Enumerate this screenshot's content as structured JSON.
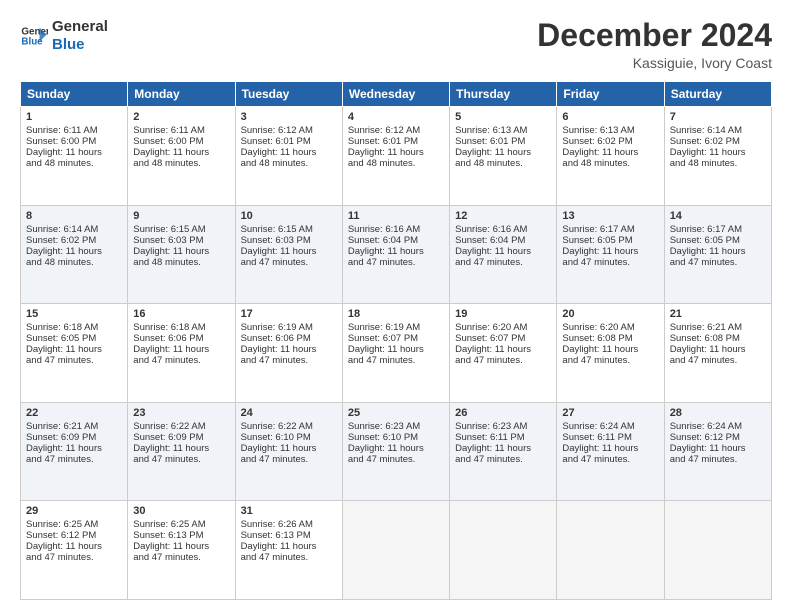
{
  "logo": {
    "line1": "General",
    "line2": "Blue"
  },
  "title": "December 2024",
  "subtitle": "Kassiguie, Ivory Coast",
  "days_header": [
    "Sunday",
    "Monday",
    "Tuesday",
    "Wednesday",
    "Thursday",
    "Friday",
    "Saturday"
  ],
  "weeks": [
    [
      {
        "day": "1",
        "sunrise": "6:11 AM",
        "sunset": "6:00 PM",
        "daylight": "11 hours and 48 minutes."
      },
      {
        "day": "2",
        "sunrise": "6:11 AM",
        "sunset": "6:00 PM",
        "daylight": "11 hours and 48 minutes."
      },
      {
        "day": "3",
        "sunrise": "6:12 AM",
        "sunset": "6:01 PM",
        "daylight": "11 hours and 48 minutes."
      },
      {
        "day": "4",
        "sunrise": "6:12 AM",
        "sunset": "6:01 PM",
        "daylight": "11 hours and 48 minutes."
      },
      {
        "day": "5",
        "sunrise": "6:13 AM",
        "sunset": "6:01 PM",
        "daylight": "11 hours and 48 minutes."
      },
      {
        "day": "6",
        "sunrise": "6:13 AM",
        "sunset": "6:02 PM",
        "daylight": "11 hours and 48 minutes."
      },
      {
        "day": "7",
        "sunrise": "6:14 AM",
        "sunset": "6:02 PM",
        "daylight": "11 hours and 48 minutes."
      }
    ],
    [
      {
        "day": "8",
        "sunrise": "6:14 AM",
        "sunset": "6:02 PM",
        "daylight": "11 hours and 48 minutes."
      },
      {
        "day": "9",
        "sunrise": "6:15 AM",
        "sunset": "6:03 PM",
        "daylight": "11 hours and 48 minutes."
      },
      {
        "day": "10",
        "sunrise": "6:15 AM",
        "sunset": "6:03 PM",
        "daylight": "11 hours and 47 minutes."
      },
      {
        "day": "11",
        "sunrise": "6:16 AM",
        "sunset": "6:04 PM",
        "daylight": "11 hours and 47 minutes."
      },
      {
        "day": "12",
        "sunrise": "6:16 AM",
        "sunset": "6:04 PM",
        "daylight": "11 hours and 47 minutes."
      },
      {
        "day": "13",
        "sunrise": "6:17 AM",
        "sunset": "6:05 PM",
        "daylight": "11 hours and 47 minutes."
      },
      {
        "day": "14",
        "sunrise": "6:17 AM",
        "sunset": "6:05 PM",
        "daylight": "11 hours and 47 minutes."
      }
    ],
    [
      {
        "day": "15",
        "sunrise": "6:18 AM",
        "sunset": "6:05 PM",
        "daylight": "11 hours and 47 minutes."
      },
      {
        "day": "16",
        "sunrise": "6:18 AM",
        "sunset": "6:06 PM",
        "daylight": "11 hours and 47 minutes."
      },
      {
        "day": "17",
        "sunrise": "6:19 AM",
        "sunset": "6:06 PM",
        "daylight": "11 hours and 47 minutes."
      },
      {
        "day": "18",
        "sunrise": "6:19 AM",
        "sunset": "6:07 PM",
        "daylight": "11 hours and 47 minutes."
      },
      {
        "day": "19",
        "sunrise": "6:20 AM",
        "sunset": "6:07 PM",
        "daylight": "11 hours and 47 minutes."
      },
      {
        "day": "20",
        "sunrise": "6:20 AM",
        "sunset": "6:08 PM",
        "daylight": "11 hours and 47 minutes."
      },
      {
        "day": "21",
        "sunrise": "6:21 AM",
        "sunset": "6:08 PM",
        "daylight": "11 hours and 47 minutes."
      }
    ],
    [
      {
        "day": "22",
        "sunrise": "6:21 AM",
        "sunset": "6:09 PM",
        "daylight": "11 hours and 47 minutes."
      },
      {
        "day": "23",
        "sunrise": "6:22 AM",
        "sunset": "6:09 PM",
        "daylight": "11 hours and 47 minutes."
      },
      {
        "day": "24",
        "sunrise": "6:22 AM",
        "sunset": "6:10 PM",
        "daylight": "11 hours and 47 minutes."
      },
      {
        "day": "25",
        "sunrise": "6:23 AM",
        "sunset": "6:10 PM",
        "daylight": "11 hours and 47 minutes."
      },
      {
        "day": "26",
        "sunrise": "6:23 AM",
        "sunset": "6:11 PM",
        "daylight": "11 hours and 47 minutes."
      },
      {
        "day": "27",
        "sunrise": "6:24 AM",
        "sunset": "6:11 PM",
        "daylight": "11 hours and 47 minutes."
      },
      {
        "day": "28",
        "sunrise": "6:24 AM",
        "sunset": "6:12 PM",
        "daylight": "11 hours and 47 minutes."
      }
    ],
    [
      {
        "day": "29",
        "sunrise": "6:25 AM",
        "sunset": "6:12 PM",
        "daylight": "11 hours and 47 minutes."
      },
      {
        "day": "30",
        "sunrise": "6:25 AM",
        "sunset": "6:13 PM",
        "daylight": "11 hours and 47 minutes."
      },
      {
        "day": "31",
        "sunrise": "6:26 AM",
        "sunset": "6:13 PM",
        "daylight": "11 hours and 47 minutes."
      },
      null,
      null,
      null,
      null
    ]
  ],
  "labels": {
    "sunrise": "Sunrise: ",
    "sunset": "Sunset: ",
    "daylight": "Daylight: "
  }
}
